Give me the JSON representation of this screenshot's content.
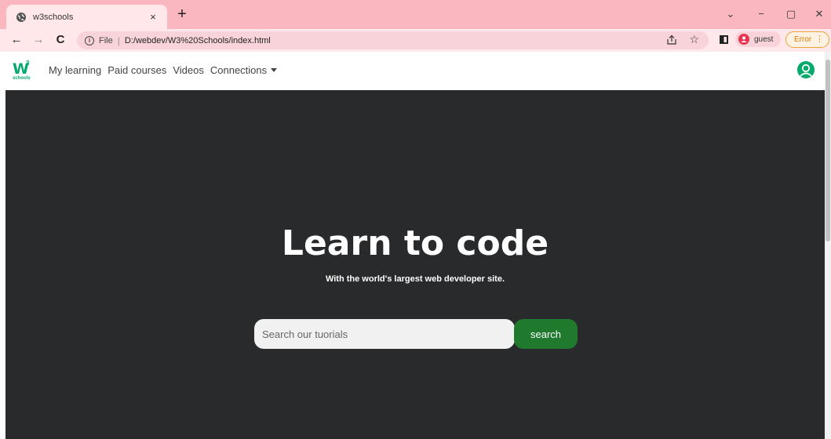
{
  "browser": {
    "tab": {
      "title": "w3schools",
      "close": "×"
    },
    "new_tab": "+",
    "window_controls": {
      "dropdown": "⌄",
      "minimize": "−",
      "restore": "▢",
      "close": "✕"
    },
    "nav": {
      "back": "←",
      "forward": "→",
      "reload": "C"
    },
    "address": {
      "protocol": "File",
      "separator": "|",
      "url": "D:/webdev/W3%20Schools/index.html"
    },
    "profile": {
      "name": "guest"
    },
    "error_button": {
      "label": "Error",
      "menu": "⋮"
    },
    "colors": {
      "tabstrip": "#fbb7c0",
      "toolbar": "#ffe7ea"
    }
  },
  "site": {
    "logo": {
      "mark": "W",
      "superscript": "3",
      "word": "schools"
    },
    "nav_links": [
      "My learning",
      "Paid courses",
      "Videos",
      "Connections"
    ],
    "hero": {
      "title": "Learn to code",
      "subtitle": "With the world's largest web developer site.",
      "search_placeholder": "Search our tuorials",
      "search_button": "search"
    },
    "colors": {
      "hero_bg": "#282a2b",
      "brand_green": "#04aa6d",
      "search_button": "#1f7a2e"
    }
  }
}
